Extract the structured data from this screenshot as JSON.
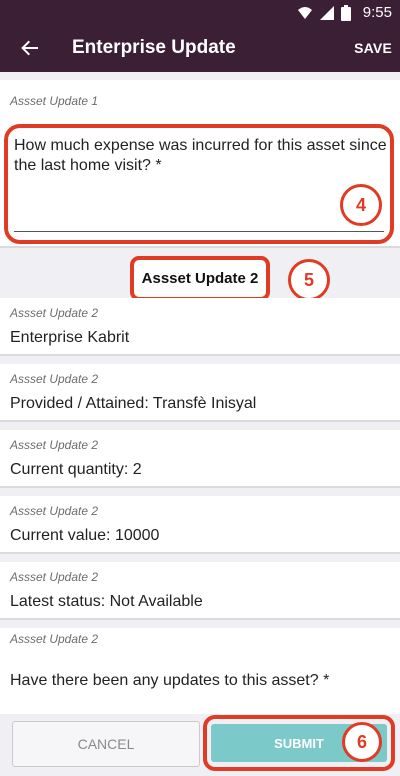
{
  "status_bar": {
    "time": "9:55",
    "icons": [
      "wifi-icon",
      "cell-signal-icon",
      "battery-icon"
    ]
  },
  "app_bar": {
    "title": "Enterprise Update",
    "save_label": "SAVE",
    "back_icon": "arrow-left-icon"
  },
  "question_card": {
    "label": "Assset Update 1",
    "question": "How much expense was incurred for this asset since the last home visit? *",
    "badge": "4"
  },
  "section": {
    "title": "Assset Update 2",
    "badge": "5"
  },
  "items": [
    {
      "label": "Assset Update 2",
      "value": "Enterprise Kabrit"
    },
    {
      "label": "Assset Update 2",
      "value": "Provided / Attained: Transfè Inisyal"
    },
    {
      "label": "Assset Update 2",
      "value": "Current quantity: 2"
    },
    {
      "label": "Assset Update 2",
      "value": "Current value: 10000"
    },
    {
      "label": "Assset Update 2",
      "value": "Latest status: Not Available"
    },
    {
      "label": "Assset Update 2",
      "value": "Have there been any updates to this asset? *"
    }
  ],
  "footer": {
    "cancel_label": "CANCEL",
    "submit_label": "SUBMIT",
    "badge": "6"
  },
  "colors": {
    "app_bar": "#3b1f35",
    "accent_highlight": "#e03b24",
    "submit": "#7cc9c9"
  }
}
